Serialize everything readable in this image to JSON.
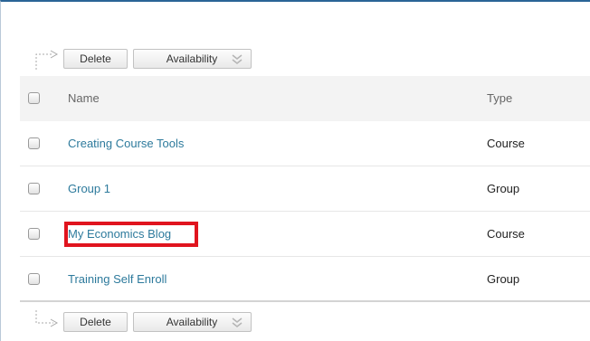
{
  "toolbar": {
    "delete_label": "Delete",
    "availability_label": "Availability"
  },
  "table": {
    "headers": {
      "name": "Name",
      "type": "Type"
    },
    "rows": [
      {
        "name": "Creating Course Tools",
        "type": "Course"
      },
      {
        "name": "Group 1",
        "type": "Group"
      },
      {
        "name": "My Economics Blog",
        "type": "Course",
        "highlighted": true
      },
      {
        "name": "Training Self Enroll",
        "type": "Group"
      }
    ]
  },
  "colors": {
    "link": "#2d7a9c",
    "highlight_border": "#e0141e",
    "header_bg": "#f3f3f3",
    "top_border": "#2a6496"
  },
  "icons": {
    "toolbar_arrow": "corner-arrow-icon",
    "availability_menu": "double-chevron-down-icon"
  }
}
